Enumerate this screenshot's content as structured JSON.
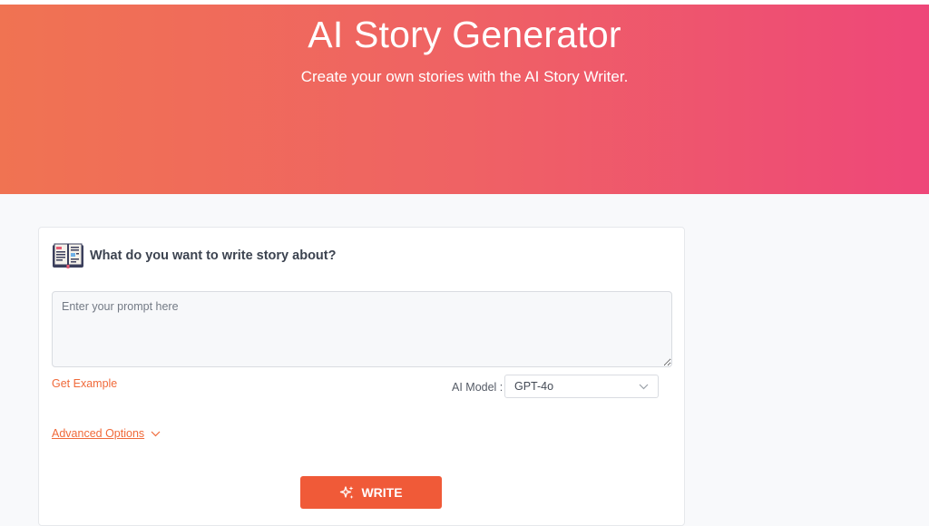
{
  "hero": {
    "title": "AI Story Generator",
    "subtitle": "Create your own stories with the AI Story Writer."
  },
  "card": {
    "title": "What do you want to write story about?",
    "icon": "open-book-icon",
    "prompt": {
      "placeholder": "Enter your prompt here",
      "value": ""
    },
    "get_example": "Get Example",
    "model": {
      "label": "AI Model :",
      "selected": "GPT-4o"
    },
    "advanced_options": "Advanced Options",
    "write_button": "WRITE"
  },
  "colors": {
    "hero_gradient_start": "#f07352",
    "hero_gradient_end": "#ee4779",
    "accent": "#f05a38",
    "link": "#f06a3a"
  }
}
